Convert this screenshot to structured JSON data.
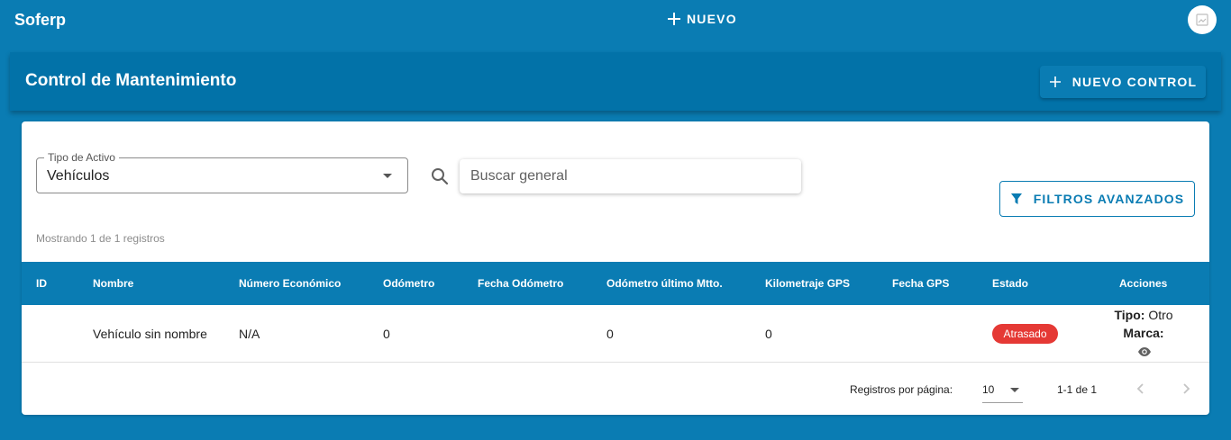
{
  "appbar": {
    "brand": "Soferp",
    "new_label": "NUEVO",
    "avatar_icon": "broken-image-icon"
  },
  "header": {
    "title": "Control de Mantenimiento",
    "new_control_label": "NUEVO CONTROL"
  },
  "filters": {
    "asset_type_label": "Tipo de Activo",
    "asset_type_value": "Vehículos",
    "search_placeholder": "Buscar general",
    "advanced_filters_label": "FILTROS AVANZADOS",
    "records_info": "Mostrando 1 de 1 registros"
  },
  "table": {
    "columns": [
      "ID",
      "Nombre",
      "Número Económico",
      "Odómetro",
      "Fecha Odómetro",
      "Odómetro último Mtto.",
      "Kilometraje GPS",
      "Fecha GPS",
      "Estado",
      "Acciones"
    ],
    "rows": [
      {
        "id": "",
        "nombre": "Vehículo sin nombre",
        "numero_economico": "N/A",
        "odometro": "0",
        "fecha_odometro": "",
        "odometro_ultimo_mtto": "0",
        "kilometraje_gps": "0",
        "fecha_gps": "",
        "estado": "Atrasado",
        "acciones": {
          "tipo_label": "Tipo:",
          "tipo_value": "Otro",
          "marca_label": "Marca:",
          "marca_value": ""
        }
      }
    ]
  },
  "pagination": {
    "rows_per_page_label": "Registros por página:",
    "rows_per_page_value": "10",
    "range": "1-1 de 1"
  },
  "colors": {
    "primary": "#0a7cb3",
    "header_card": "#0272a8",
    "status_overdue": "#e53935"
  }
}
